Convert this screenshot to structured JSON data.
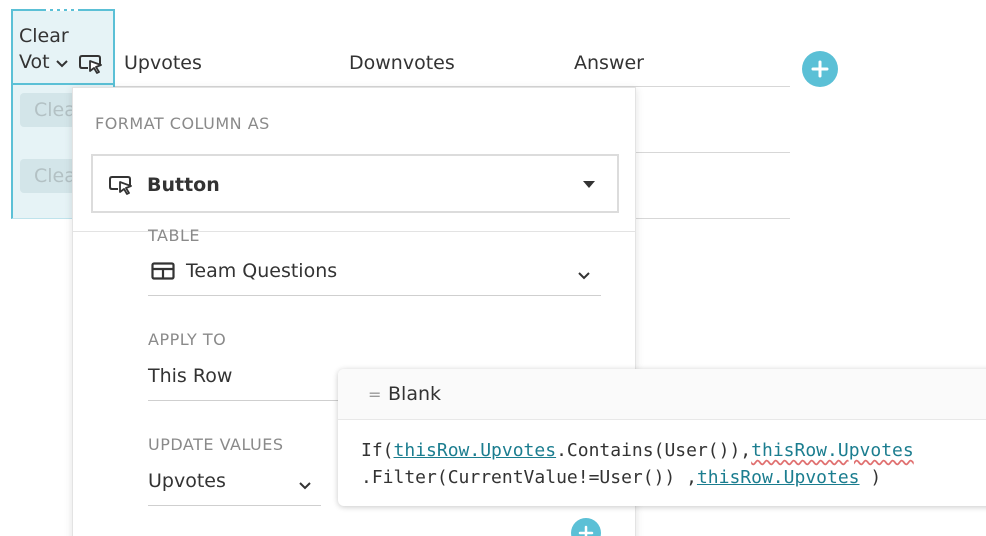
{
  "table": {
    "selected_column": {
      "title_line1": "Clear",
      "title_line2": "Vot",
      "cell_label": "Clear"
    },
    "columns": [
      "Upvotes",
      "Downvotes",
      "Answer"
    ]
  },
  "popover": {
    "section_title": "FORMAT COLUMN AS",
    "format_value": "Button",
    "table_label": "TABLE",
    "table_value": "Team Questions",
    "apply_to_label": "APPLY TO",
    "apply_to_value": "This Row",
    "update_values_label": "UPDATE VALUES",
    "update_values_value": "Upvotes"
  },
  "formula": {
    "result_prefix": "=",
    "result_value": "Blank",
    "tokens_line1": [
      "If(",
      "thisRow.Upvotes",
      ".Contains(User()),",
      "thisRow.Upvotes"
    ],
    "tokens_line2": [
      ".Filter(CurrentValue!=User()) ,",
      "thisRow.Upvotes",
      " )"
    ]
  },
  "icons": {
    "button_icon": "cursor-click-icon",
    "table_icon": "table-grid-icon",
    "chevron": "chevron-down-icon",
    "add": "plus-icon"
  },
  "colors": {
    "accent": "#5bc0d6",
    "selected_bg": "#e6f3f6",
    "formula_ref": "#1b7d8f"
  }
}
